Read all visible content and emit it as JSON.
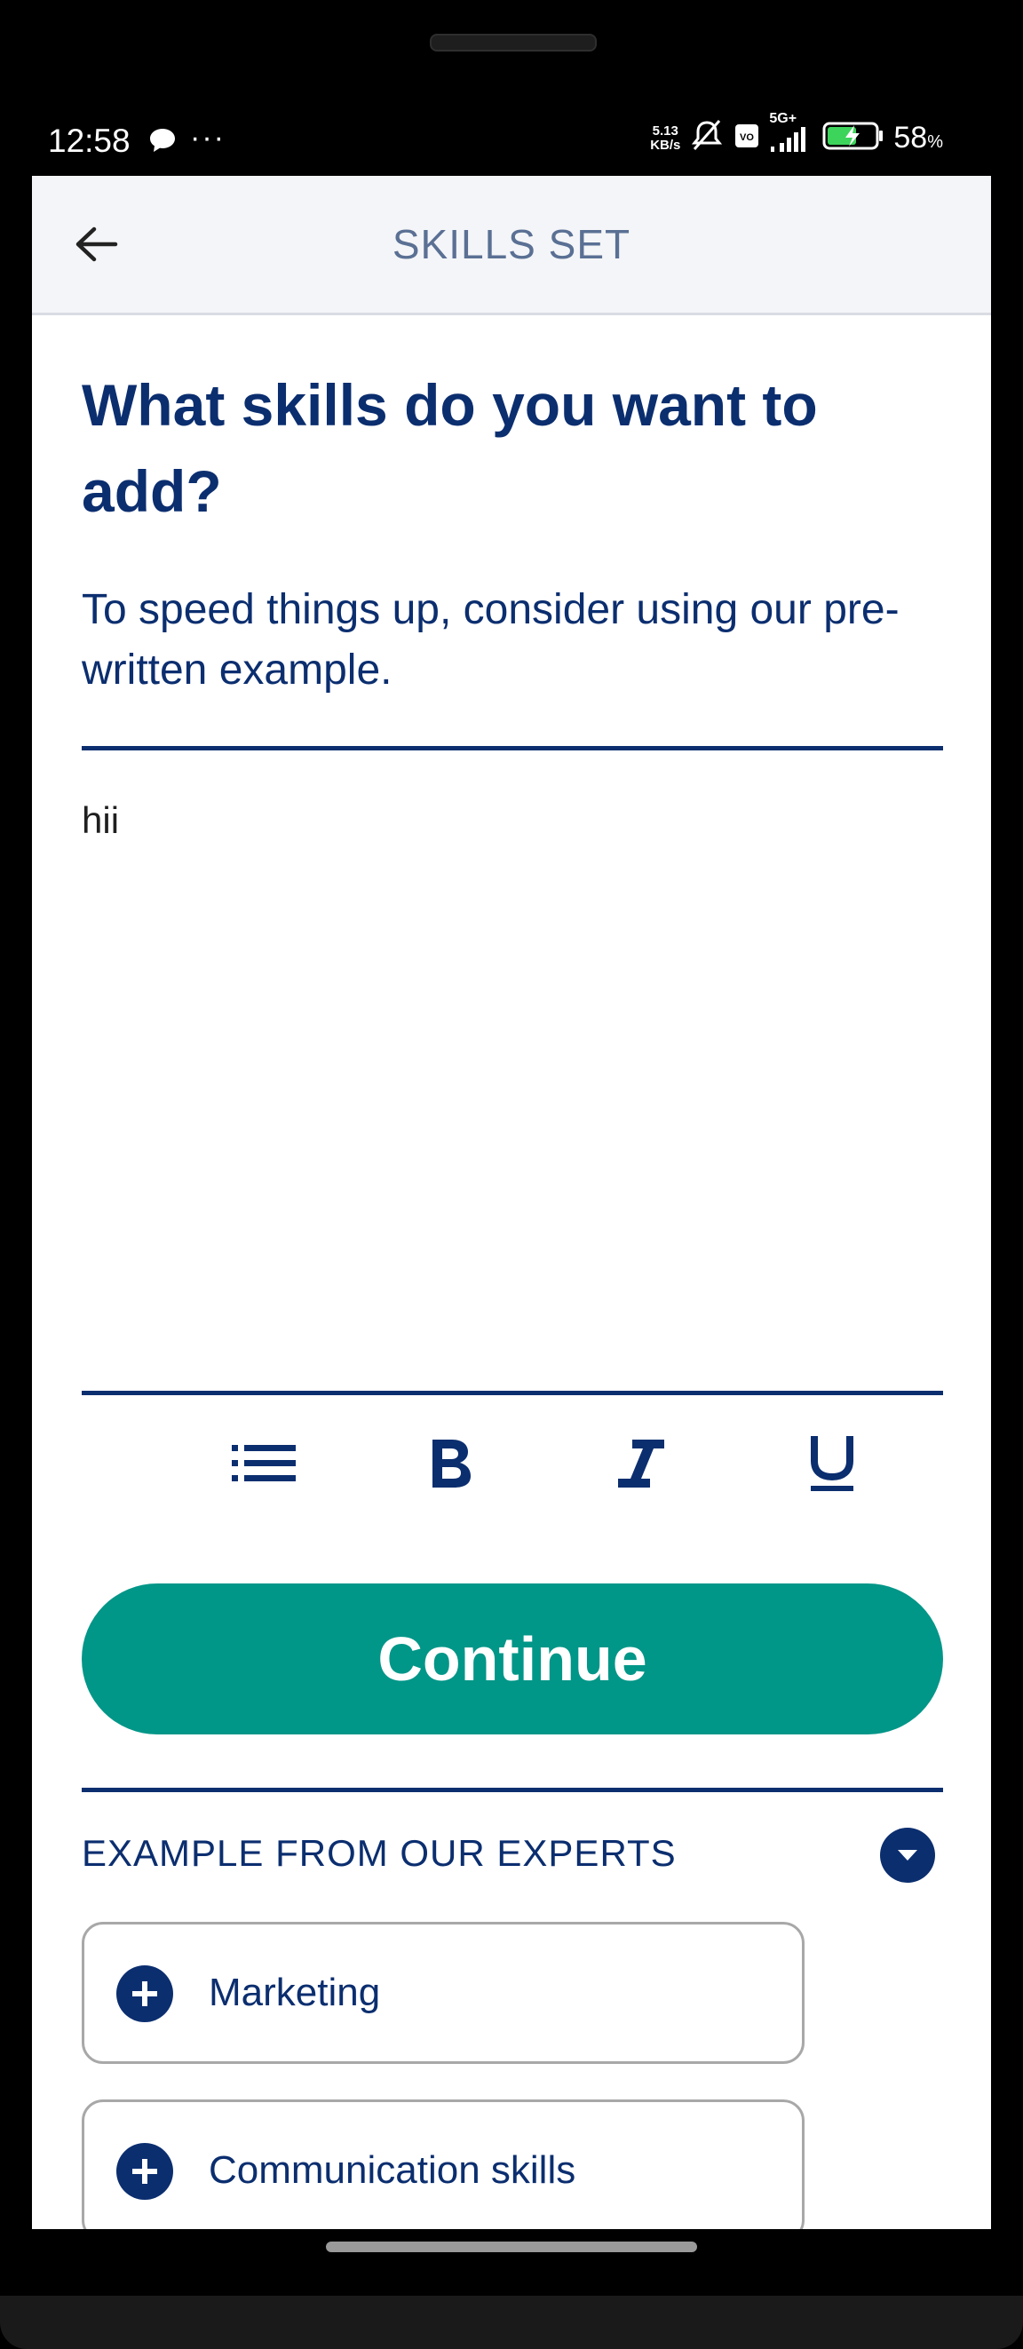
{
  "status_bar": {
    "time": "12:58",
    "speed_value": "5.13",
    "speed_unit": "KB/s",
    "network": "5G+",
    "battery_percent": "58",
    "battery_unit": "%"
  },
  "app_bar": {
    "title": "SKILLS SET"
  },
  "main": {
    "heading": "What skills do you want to add?",
    "subtext": "To speed things up, consider using our pre-written example.",
    "editor_value": "hii",
    "continue_label": "Continue"
  },
  "examples": {
    "title": "EXAMPLE FROM OUR EXPERTS",
    "items": [
      {
        "label": "Marketing"
      },
      {
        "label": "Communication skills"
      }
    ]
  },
  "colors": {
    "primary": "#0b2e6f",
    "accent": "#009688",
    "appbar_bg": "#f4f5f8"
  }
}
